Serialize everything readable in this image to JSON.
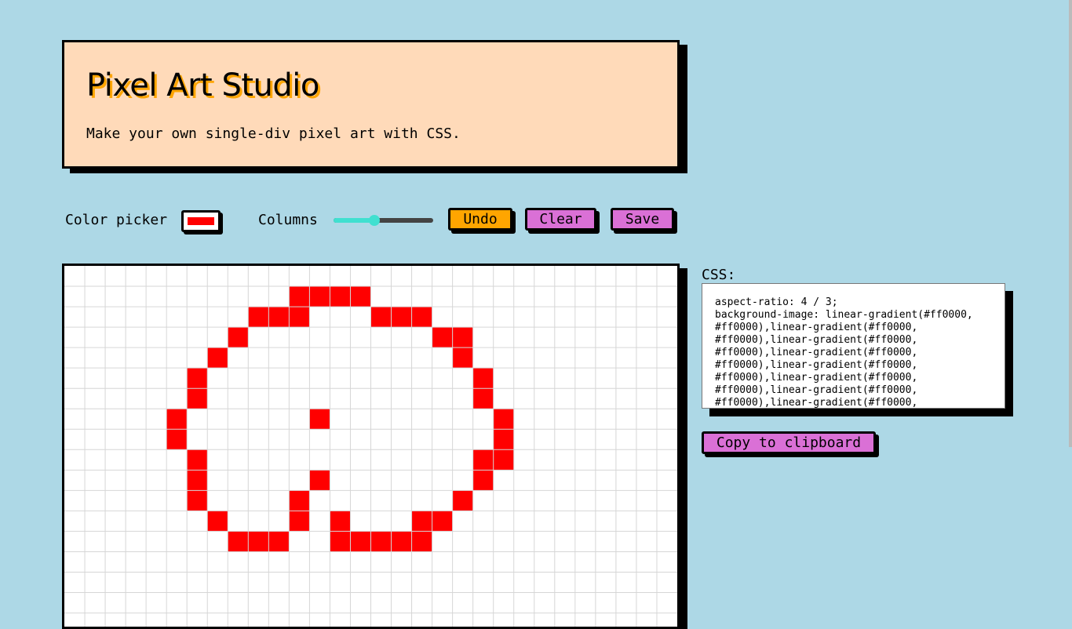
{
  "header": {
    "title": "Pixel Art Studio",
    "subtitle": "Make your own single-div pixel art with CSS."
  },
  "toolbar": {
    "color_picker_label": "Color picker",
    "selected_color": "#ff0000",
    "columns_label": "Columns",
    "columns_slider_fraction": 0.41,
    "undo_label": "Undo",
    "clear_label": "Clear",
    "save_label": "Save"
  },
  "canvas": {
    "columns": 30,
    "rows": 17,
    "background_color": "#ffffff",
    "grid_line_color": "#d6d6d6",
    "pixel_color": "#ff0000",
    "filled_cells": [
      [
        11,
        1
      ],
      [
        12,
        1
      ],
      [
        13,
        1
      ],
      [
        14,
        1
      ],
      [
        9,
        2
      ],
      [
        10,
        2
      ],
      [
        11,
        2
      ],
      [
        15,
        2
      ],
      [
        16,
        2
      ],
      [
        17,
        2
      ],
      [
        8,
        3
      ],
      [
        18,
        3
      ],
      [
        19,
        3
      ],
      [
        7,
        4
      ],
      [
        19,
        4
      ],
      [
        6,
        5
      ],
      [
        20,
        5
      ],
      [
        6,
        6
      ],
      [
        20,
        6
      ],
      [
        5,
        7
      ],
      [
        12,
        7
      ],
      [
        21,
        7
      ],
      [
        5,
        8
      ],
      [
        21,
        8
      ],
      [
        6,
        9
      ],
      [
        20,
        9
      ],
      [
        21,
        9
      ],
      [
        6,
        10
      ],
      [
        12,
        10
      ],
      [
        20,
        10
      ],
      [
        6,
        11
      ],
      [
        11,
        11
      ],
      [
        19,
        11
      ],
      [
        7,
        12
      ],
      [
        11,
        12
      ],
      [
        13,
        12
      ],
      [
        17,
        12
      ],
      [
        18,
        12
      ],
      [
        8,
        13
      ],
      [
        9,
        13
      ],
      [
        10,
        13
      ],
      [
        13,
        13
      ],
      [
        14,
        13
      ],
      [
        15,
        13
      ],
      [
        16,
        13
      ],
      [
        17,
        13
      ]
    ]
  },
  "css_panel": {
    "label": "CSS:",
    "code": "aspect-ratio: 4 / 3;\nbackground-image: linear-gradient(#ff0000,\n#ff0000),linear-gradient(#ff0000,\n#ff0000),linear-gradient(#ff0000,\n#ff0000),linear-gradient(#ff0000,\n#ff0000),linear-gradient(#ff0000,\n#ff0000),linear-gradient(#ff0000,\n#ff0000),linear-gradient(#ff0000,\n#ff0000),linear-gradient(#ff0000,",
    "copy_label": "Copy to clipboard"
  },
  "colors": {
    "page_background": "#add8e6",
    "header_background": "#ffdab9",
    "title_shadow": "#ffa500",
    "undo_button": "#ffa500",
    "action_buttons": "#da70d6",
    "slider_accent": "#40e0d0"
  }
}
